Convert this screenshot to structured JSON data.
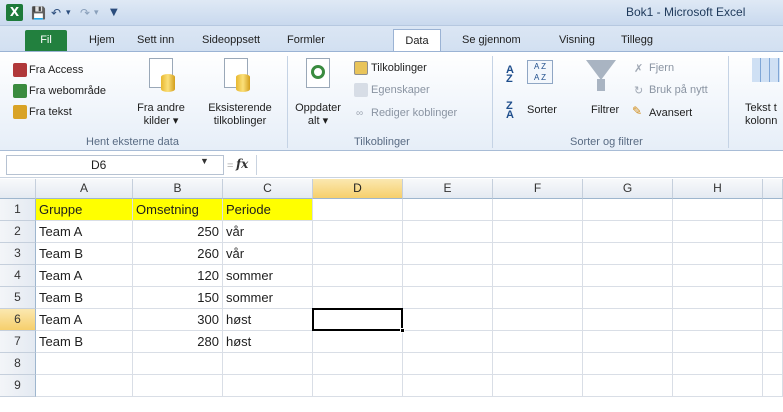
{
  "window": {
    "title": "Bok1 - Microsoft Excel",
    "logo_letter": "X",
    "quick_access": [
      "save",
      "undo",
      "redo",
      "customize"
    ]
  },
  "tabs": [
    {
      "label": "Fil",
      "key": "file"
    },
    {
      "label": "Hjem",
      "key": "home"
    },
    {
      "label": "Sett inn",
      "key": "insert"
    },
    {
      "label": "Sideoppsett",
      "key": "pagelayout"
    },
    {
      "label": "Formler",
      "key": "formulas"
    },
    {
      "label": "Data",
      "key": "data",
      "active": true
    },
    {
      "label": "Se gjennom",
      "key": "review"
    },
    {
      "label": "Visning",
      "key": "view"
    },
    {
      "label": "Tillegg",
      "key": "addins"
    }
  ],
  "ribbon": {
    "external_data": {
      "from_access": "Fra Access",
      "from_web": "Fra webområde",
      "from_text": "Fra tekst",
      "from_other_line1": "Fra andre",
      "from_other_line2": "kilder ▾",
      "existing_line1": "Eksisterende",
      "existing_line2": "tilkoblinger",
      "group_label": "Hent eksterne data"
    },
    "connections": {
      "refresh_line1": "Oppdater",
      "refresh_line2": "alt ▾",
      "connections": "Tilkoblinger",
      "properties": "Egenskaper",
      "edit_links": "Rediger koblinger",
      "group_label": "Tilkoblinger"
    },
    "sort_filter": {
      "sort": "Sorter",
      "filter": "Filtrer",
      "clear": "Fjern",
      "reapply": "Bruk på nytt",
      "advanced": "Avansert",
      "group_label": "Sorter og filtrer"
    },
    "text_to_columns": {
      "line1": "Tekst t",
      "line2": "kolonn"
    }
  },
  "formula_bar": {
    "name_box": "D6",
    "fx_label": "fx",
    "equals_label": "=",
    "value": ""
  },
  "sheet": {
    "columns": [
      "A",
      "B",
      "C",
      "D",
      "E",
      "F",
      "G",
      "H"
    ],
    "active_column": "D",
    "active_row": 6,
    "row_numbers": [
      "1",
      "2",
      "3",
      "4",
      "5",
      "6",
      "7",
      "8",
      "9"
    ],
    "rows": [
      {
        "A": "Gruppe",
        "B": "Omsetning",
        "C": "Periode"
      },
      {
        "A": "Team A",
        "B": "250",
        "C": "vår"
      },
      {
        "A": "Team B",
        "B": "260",
        "C": "vår"
      },
      {
        "A": "Team A",
        "B": "120",
        "C": "sommer"
      },
      {
        "A": "Team B",
        "B": "150",
        "C": "sommer"
      },
      {
        "A": "Team A",
        "B": "300",
        "C": "høst"
      },
      {
        "A": "Team B",
        "B": "280",
        "C": "høst"
      },
      {
        "A": "",
        "B": "",
        "C": ""
      },
      {
        "A": "",
        "B": "",
        "C": ""
      }
    ],
    "header_fill_color": "#ffff00",
    "selected_cell": "D6"
  }
}
